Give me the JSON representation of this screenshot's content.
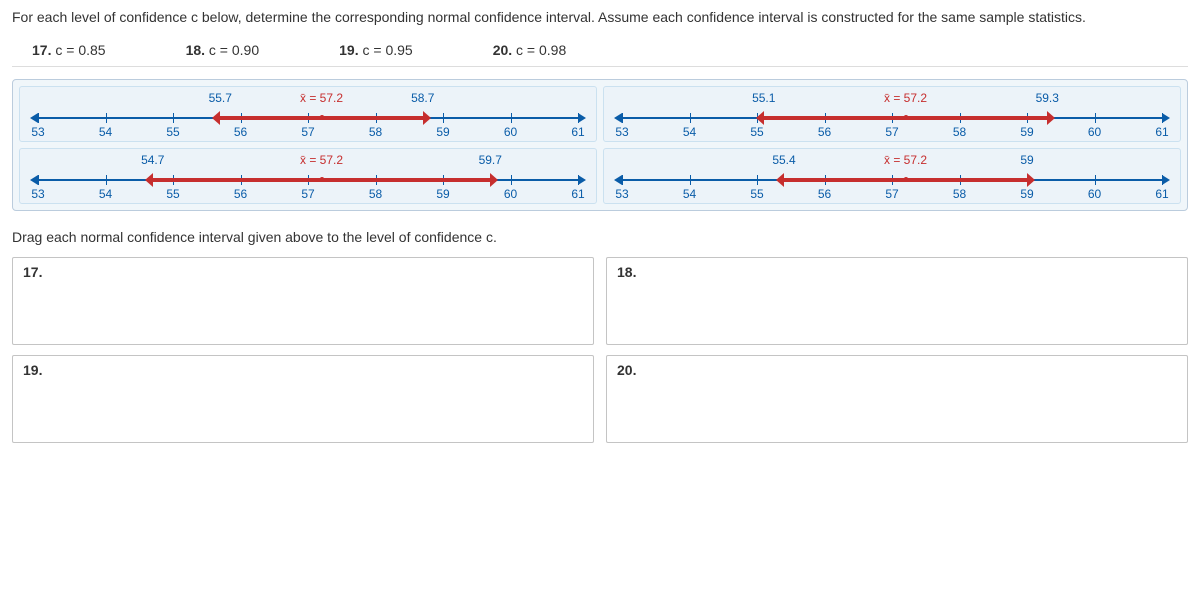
{
  "question": "For each level of confidence c below, determine the corresponding normal confidence interval. Assume each confidence interval is constructed for the same sample statistics.",
  "options": [
    {
      "num": "17.",
      "text": "c = 0.85"
    },
    {
      "num": "18.",
      "text": "c = 0.90"
    },
    {
      "num": "19.",
      "text": "c = 0.95"
    },
    {
      "num": "20.",
      "text": "c = 0.98"
    }
  ],
  "axis": {
    "min": 53,
    "max": 61,
    "ticks": [
      53,
      54,
      55,
      56,
      57,
      58,
      59,
      60,
      61
    ]
  },
  "mean_label": "x̄ = 57.2",
  "mean": 57.2,
  "intervals": [
    {
      "low": 55.7,
      "high": 58.7,
      "low_s": "55.7",
      "high_s": "58.7"
    },
    {
      "low": 55.1,
      "high": 59.3,
      "low_s": "55.1",
      "high_s": "59.3"
    },
    {
      "low": 54.7,
      "high": 59.7,
      "low_s": "54.7",
      "high_s": "59.7"
    },
    {
      "low": 55.4,
      "high": 59.0,
      "low_s": "55.4",
      "high_s": "59"
    }
  ],
  "instruction": "Drag each normal confidence interval given above to the level of confidence c.",
  "drop_labels": [
    "17.",
    "18.",
    "19.",
    "20."
  ]
}
